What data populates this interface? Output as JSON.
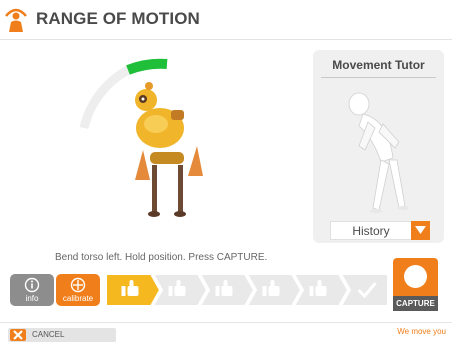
{
  "header": {
    "title": "RANGE OF MOTION",
    "logo_icon": "person-logo-icon"
  },
  "instruction": "Bend torso left. Hold position. Press CAPTURE.",
  "tutor": {
    "title": "Movement Tutor",
    "history_label": "History",
    "figure": "mannequin-bending-figure"
  },
  "toolbar": {
    "info_label": "info",
    "calibrate_label": "calibrate",
    "steps": [
      {
        "icon": "thumbs-up-icon",
        "active": true
      },
      {
        "icon": "thumbs-up-icon",
        "active": false
      },
      {
        "icon": "thumbs-up-icon",
        "active": false
      },
      {
        "icon": "thumbs-up-icon",
        "active": false
      },
      {
        "icon": "thumbs-up-icon",
        "active": false
      },
      {
        "icon": "checkmark-icon",
        "active": false
      }
    ],
    "capture_label": "CAPTURE"
  },
  "footer": {
    "cancel_label": "CANCEL",
    "tagline": "We move you"
  },
  "colors": {
    "accent": "#f07e1b",
    "gauge_active": "#1fbf3a",
    "gray_tile": "#8d8d8d"
  }
}
